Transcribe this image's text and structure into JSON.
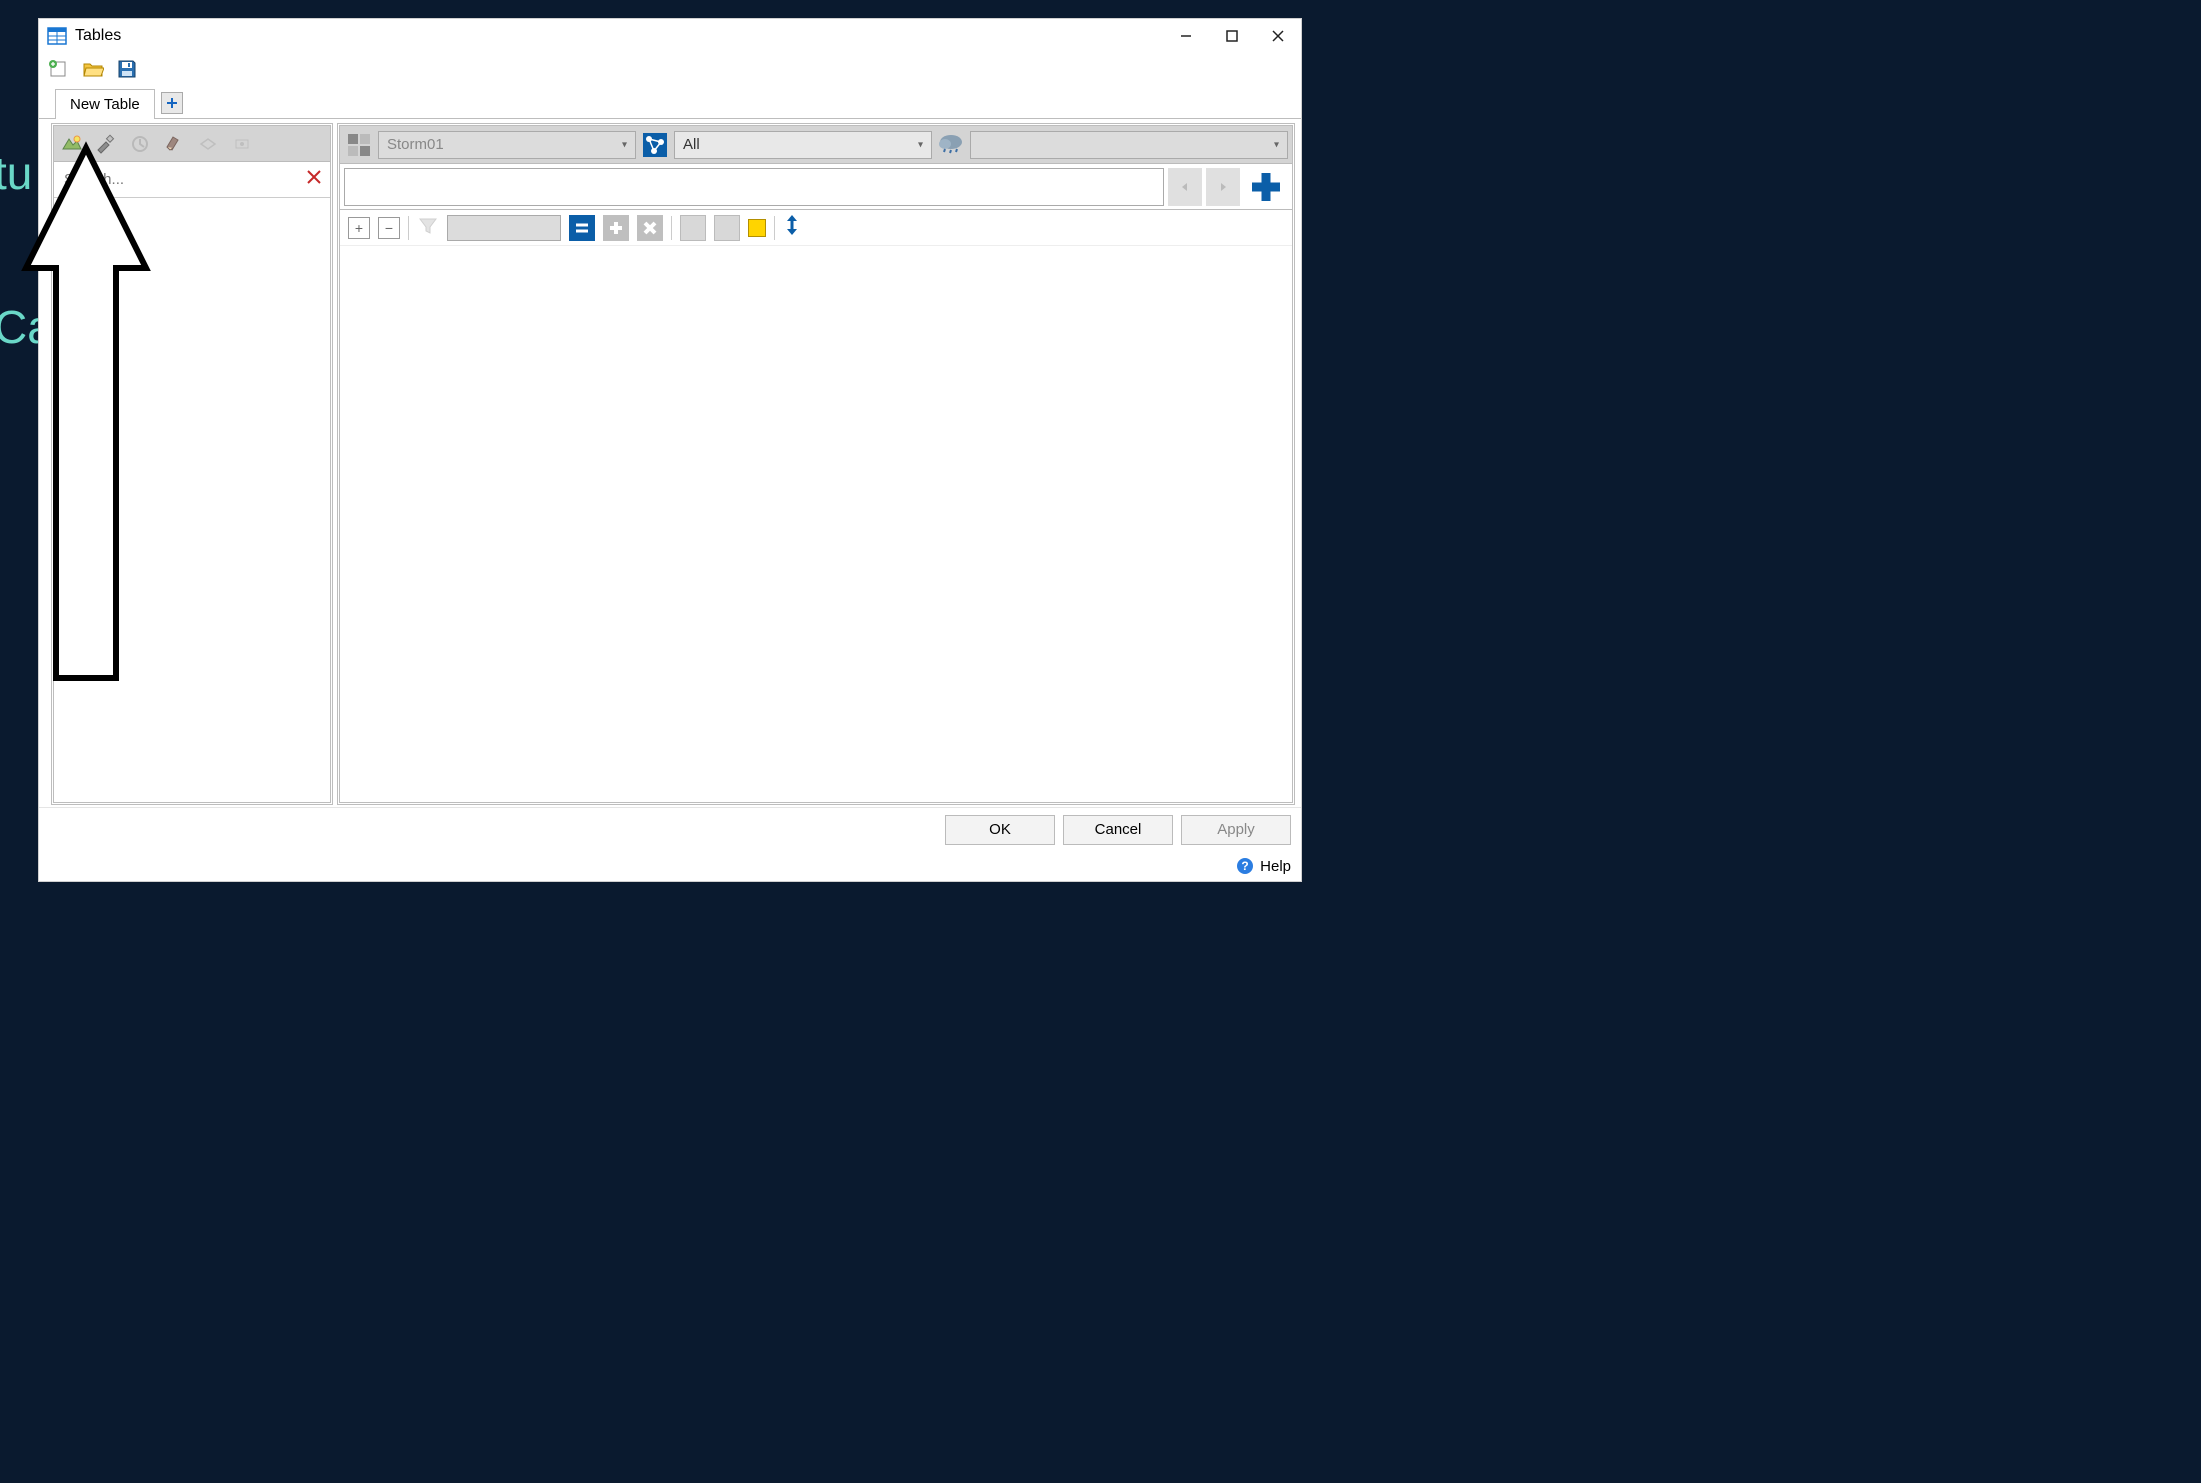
{
  "title": "Tables",
  "tabs": {
    "active": "New Table"
  },
  "left": {
    "search_placeholder": "Search..."
  },
  "right": {
    "storm_label": "Storm01",
    "filter_label": "All"
  },
  "footer": {
    "ok": "OK",
    "cancel": "Cancel",
    "apply": "Apply"
  },
  "help": "Help",
  "bg": {
    "tu": "tu",
    "ca": "Ca"
  }
}
